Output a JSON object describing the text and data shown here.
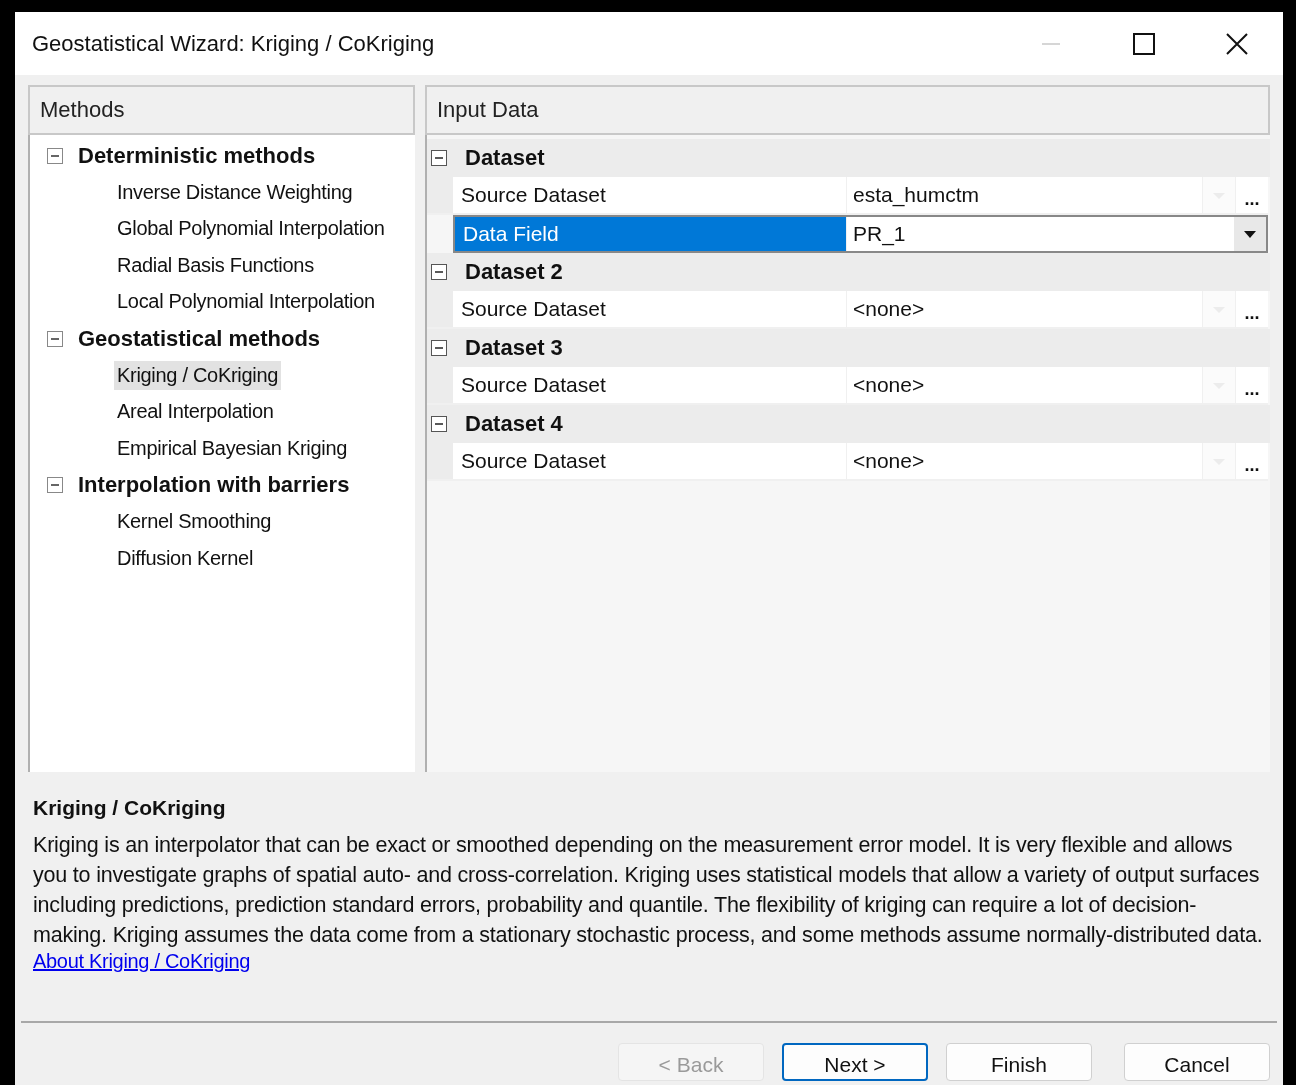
{
  "window": {
    "title": "Geostatistical Wizard: Kriging / CoKriging"
  },
  "methods_panel": {
    "title": "Methods",
    "groups": [
      {
        "label": "Deterministic methods",
        "expanded": true,
        "children": [
          {
            "label": "Inverse Distance Weighting",
            "selected": false
          },
          {
            "label": "Global Polynomial Interpolation",
            "selected": false
          },
          {
            "label": "Radial Basis Functions",
            "selected": false
          },
          {
            "label": "Local Polynomial Interpolation",
            "selected": false
          }
        ]
      },
      {
        "label": "Geostatistical methods",
        "expanded": true,
        "children": [
          {
            "label": "Kriging / CoKriging",
            "selected": true
          },
          {
            "label": "Areal Interpolation",
            "selected": false
          },
          {
            "label": "Empirical Bayesian Kriging",
            "selected": false
          }
        ]
      },
      {
        "label": "Interpolation with barriers",
        "expanded": true,
        "children": [
          {
            "label": "Kernel Smoothing",
            "selected": false
          },
          {
            "label": "Diffusion Kernel",
            "selected": false
          }
        ]
      }
    ]
  },
  "input_panel": {
    "title": "Input Data",
    "categories": [
      {
        "label": "Dataset",
        "expanded": true,
        "properties": [
          {
            "name": "Source Dataset",
            "value": "esta_humctm",
            "kind": "browse",
            "button": "...",
            "selected": false
          },
          {
            "name": "Data Field",
            "value": "PR_1",
            "kind": "dropdown",
            "selected": true
          }
        ]
      },
      {
        "label": "Dataset 2",
        "expanded": true,
        "properties": [
          {
            "name": "Source Dataset",
            "value": "<none>",
            "kind": "browse",
            "button": "...",
            "selected": false
          }
        ]
      },
      {
        "label": "Dataset 3",
        "expanded": true,
        "properties": [
          {
            "name": "Source Dataset",
            "value": "<none>",
            "kind": "browse",
            "button": "...",
            "selected": false
          }
        ]
      },
      {
        "label": "Dataset 4",
        "expanded": true,
        "properties": [
          {
            "name": "Source Dataset",
            "value": "<none>",
            "kind": "browse",
            "button": "...",
            "selected": false
          }
        ]
      }
    ]
  },
  "description": {
    "title": "Kriging / CoKriging",
    "text": "Kriging is an interpolator that can be exact or smoothed depending on the measurement error model. It is very flexible and allows you to investigate graphs of spatial auto- and cross-correlation. Kriging uses statistical models that allow a variety of output surfaces including predictions, prediction standard errors, probability and quantile. The flexibility of kriging can require a lot of decision-making. Kriging assumes the data come from a stationary stochastic process, and some methods assume normally-distributed data.",
    "link": "About Kriging / CoKriging"
  },
  "buttons": [
    {
      "label": "< Back",
      "disabled": true,
      "default": false
    },
    {
      "label": "Next >",
      "disabled": false,
      "default": true
    },
    {
      "label": "Finish",
      "disabled": false,
      "default": false
    },
    {
      "label": "Cancel",
      "disabled": false,
      "default": false
    }
  ]
}
